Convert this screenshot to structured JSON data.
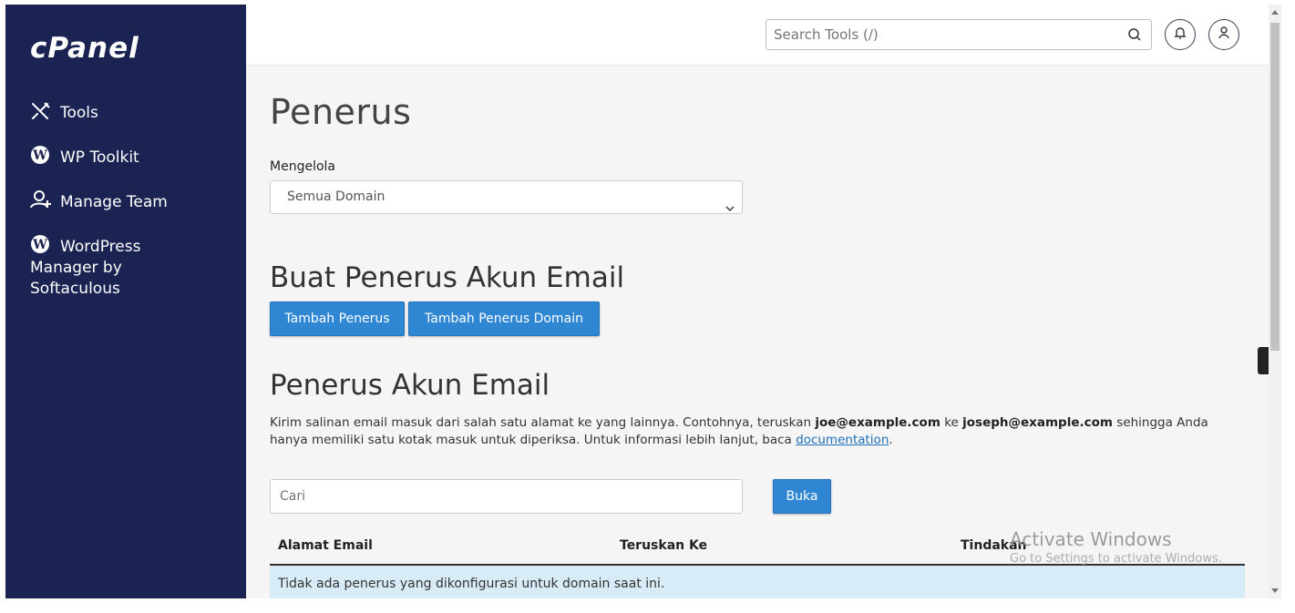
{
  "sidebar": {
    "logo": "cPanel",
    "items": [
      {
        "label": "Tools",
        "icon": "tools-icon"
      },
      {
        "label": "WP Toolkit",
        "icon": "wordpress-icon"
      },
      {
        "label": "Manage Team",
        "icon": "add-user-icon"
      },
      {
        "label_line1": "WordPress",
        "label_line2": "Manager by",
        "label_line3": "Softaculous",
        "icon": "wordpress-icon"
      }
    ]
  },
  "header": {
    "search_placeholder": "Search Tools (/)",
    "icons": [
      "search-icon",
      "bell-icon",
      "user-icon"
    ]
  },
  "main": {
    "title": "Penerus",
    "manage_label": "Mengelola",
    "domain_selected": "Semua Domain",
    "create_heading": "Buat Penerus Akun Email",
    "btn_add_forwarder": "Tambah Penerus",
    "btn_add_domain_forwarder": "Tambah Penerus Domain",
    "list_heading": "Penerus Akun Email",
    "desc_part1": "Kirim salinan email masuk dari salah satu alamat ke yang lainnya. Contohnya, teruskan ",
    "desc_email1": "joe@example.com",
    "desc_part2": " ke ",
    "desc_email2": "joseph@example.com",
    "desc_part3": " sehingga Anda hanya memiliki satu kotak masuk untuk diperiksa. Untuk informasi lebih lanjut, baca ",
    "desc_link": "documentation",
    "desc_part4": ".",
    "filter_placeholder": "Cari",
    "btn_go": "Buka",
    "table": {
      "columns": [
        "Alamat Email",
        "Teruskan Ke",
        "Tindakan"
      ],
      "empty_message": "Tidak ada penerus yang dikonfigurasi untuk domain saat ini."
    }
  },
  "watermark": {
    "line1": "Activate Windows",
    "line2": "Go to Settings to activate Windows."
  },
  "colors": {
    "sidebar_bg": "#1b2352",
    "primary_button": "#2f86d2",
    "empty_row_bg": "#d8ecf8"
  }
}
